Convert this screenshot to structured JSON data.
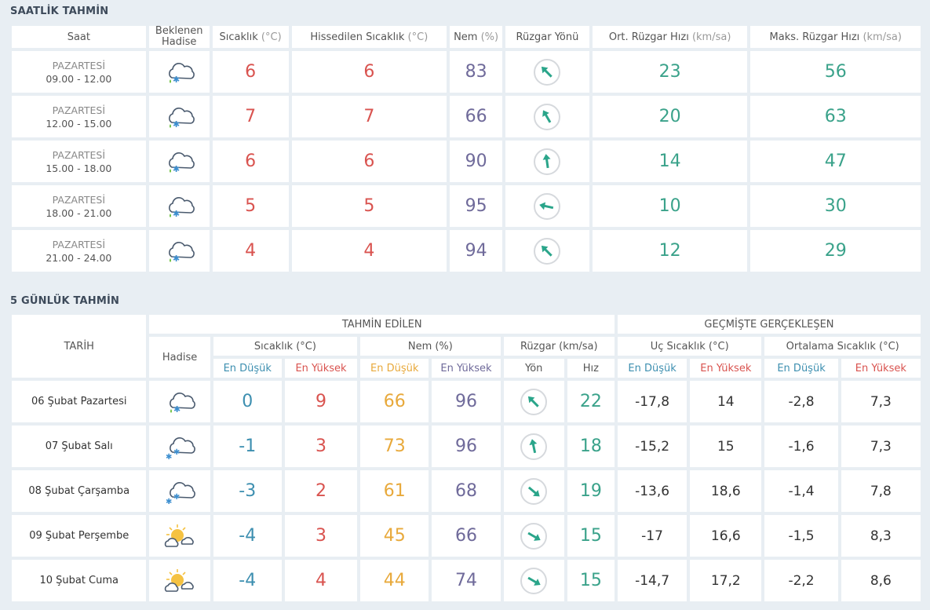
{
  "hourly": {
    "title": "SAATLİK TAHMİN",
    "headers": {
      "time": "Saat",
      "event_line1": "Beklenen",
      "event_line2": "Hadise",
      "temp": "Sıcaklık",
      "temp_unit": "(°C)",
      "feels": "Hissedilen Sıcaklık",
      "feels_unit": "(°C)",
      "humidity": "Nem",
      "humidity_unit": "(%)",
      "wind_dir": "Rüzgar Yönü",
      "avg_wind": "Ort. Rüzgar Hızı",
      "avg_wind_unit": "(km/sa)",
      "max_wind": "Maks. Rüzgar Hızı",
      "max_wind_unit": "(km/sa)"
    },
    "rows": [
      {
        "day": "PAZARTESİ",
        "time": "09.00 - 12.00",
        "icon": "sleet-cloud-icon",
        "temp": "6",
        "feels": "6",
        "humidity": "83",
        "wind_deg": -45,
        "avg_wind": "23",
        "max_wind": "56"
      },
      {
        "day": "PAZARTESİ",
        "time": "12.00 - 15.00",
        "icon": "sleet-cloud-icon",
        "temp": "7",
        "feels": "7",
        "humidity": "66",
        "wind_deg": -30,
        "avg_wind": "20",
        "max_wind": "63"
      },
      {
        "day": "PAZARTESİ",
        "time": "15.00 - 18.00",
        "icon": "sleet-cloud-icon",
        "temp": "6",
        "feels": "6",
        "humidity": "90",
        "wind_deg": -8,
        "avg_wind": "14",
        "max_wind": "47"
      },
      {
        "day": "PAZARTESİ",
        "time": "18.00 - 21.00",
        "icon": "sleet-cloud-icon",
        "temp": "5",
        "feels": "5",
        "humidity": "95",
        "wind_deg": -78,
        "avg_wind": "10",
        "max_wind": "30"
      },
      {
        "day": "PAZARTESİ",
        "time": "21.00 - 24.00",
        "icon": "sleet-cloud-icon",
        "temp": "4",
        "feels": "4",
        "humidity": "94",
        "wind_deg": -45,
        "avg_wind": "12",
        "max_wind": "29"
      }
    ]
  },
  "daily": {
    "title": "5 GÜNLÜK TAHMİN",
    "headers": {
      "date": "TARİH",
      "forecast_group": "TAHMİN EDİLEN",
      "past_group": "GEÇMİŞTE GERÇEKLEŞEN",
      "event": "Hadise",
      "temp": "Sıcaklık (°C)",
      "humidity": "Nem (%)",
      "wind": "Rüzgar (km/sa)",
      "extreme_temp": "Uç Sıcaklık (°C)",
      "avg_temp": "Ortalama Sıcaklık (°C)",
      "min": "En Düşük",
      "max": "En Yüksek",
      "direction": "Yön",
      "speed": "Hız"
    },
    "rows": [
      {
        "date": "06 Şubat Pazartesi",
        "icon": "sleet-cloud-icon",
        "tmin": "0",
        "tmax": "9",
        "hmin": "66",
        "hmax": "96",
        "wind_deg": -45,
        "wind_speed": "22",
        "ext_min": "-17,8",
        "ext_max": "14",
        "avg_min": "-2,8",
        "avg_max": "7,3"
      },
      {
        "date": "07 Şubat Salı",
        "icon": "snow-cloud-icon",
        "tmin": "-1",
        "tmax": "3",
        "hmin": "73",
        "hmax": "96",
        "wind_deg": -12,
        "wind_speed": "18",
        "ext_min": "-15,2",
        "ext_max": "15",
        "avg_min": "-1,6",
        "avg_max": "7,3"
      },
      {
        "date": "08 Şubat Çarşamba",
        "icon": "snow-cloud-icon",
        "tmin": "-3",
        "tmax": "2",
        "hmin": "61",
        "hmax": "68",
        "wind_deg": 130,
        "wind_speed": "19",
        "ext_min": "-13,6",
        "ext_max": "18,6",
        "avg_min": "-1,4",
        "avg_max": "7,8"
      },
      {
        "date": "09 Şubat Perşembe",
        "icon": "partly-sunny-icon",
        "tmin": "-4",
        "tmax": "3",
        "hmin": "45",
        "hmax": "66",
        "wind_deg": 120,
        "wind_speed": "15",
        "ext_min": "-17",
        "ext_max": "16,6",
        "avg_min": "-1,5",
        "avg_max": "8,3"
      },
      {
        "date": "10 Şubat Cuma",
        "icon": "partly-sunny-icon",
        "tmin": "-4",
        "tmax": "4",
        "hmin": "44",
        "hmax": "74",
        "wind_deg": 120,
        "wind_speed": "15",
        "ext_min": "-14,7",
        "ext_max": "17,2",
        "avg_min": "-2,2",
        "avg_max": "8,6"
      }
    ]
  }
}
